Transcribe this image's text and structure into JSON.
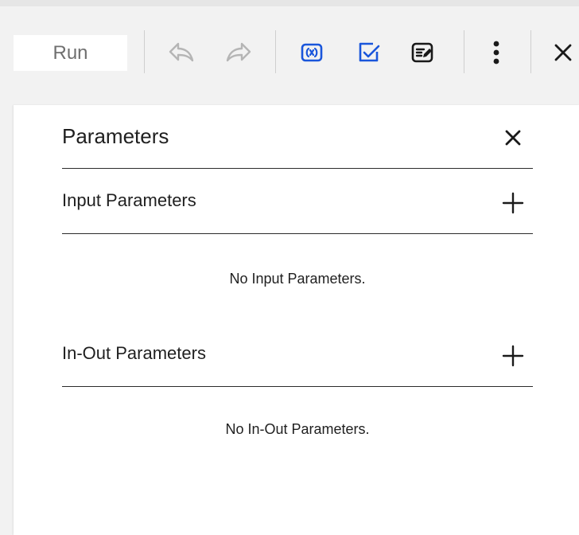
{
  "toolbar": {
    "run_label": "Run",
    "icons": {
      "undo": "undo-icon",
      "redo": "redo-icon",
      "variables": "variables-icon",
      "validate": "validate-checkbox-icon",
      "edit_script": "edit-script-icon",
      "more": "more-vertical-icon",
      "close": "close-icon"
    },
    "colors": {
      "accent": "#1a56db",
      "disabled": "#b5b5b5",
      "dark": "#1a1a1a"
    }
  },
  "panel": {
    "title": "Parameters",
    "sections": [
      {
        "title": "Input Parameters",
        "empty_message": "No Input Parameters."
      },
      {
        "title": "In-Out Parameters",
        "empty_message": "No In-Out Parameters."
      }
    ]
  }
}
